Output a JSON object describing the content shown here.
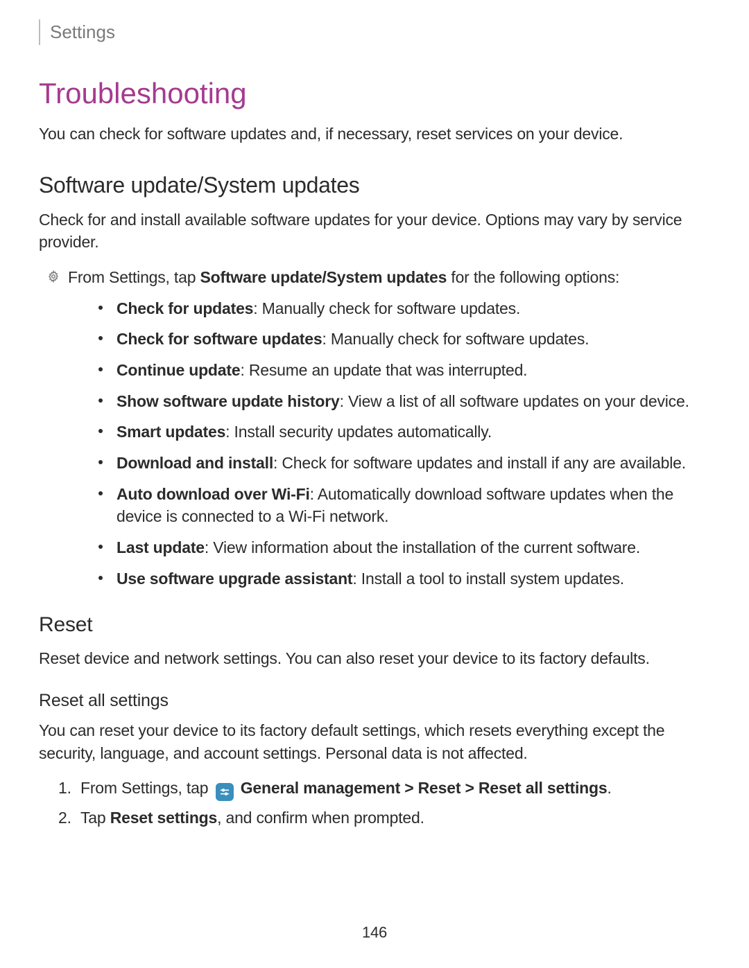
{
  "breadcrumb": "Settings",
  "title": "Troubleshooting",
  "intro": "You can check for software updates and, if necessary, reset services on your device.",
  "section_1": {
    "heading": "Software update/System updates",
    "body": "Check for and install available software updates for your device. Options may vary by service provider.",
    "gear_line_pre": "From Settings, tap ",
    "gear_line_bold": "Software update/System updates",
    "gear_line_post": " for the following options:",
    "bullets": [
      {
        "label": "Check for updates",
        "desc": ": Manually check for software updates."
      },
      {
        "label": "Check for software updates",
        "desc": ": Manually check for software updates."
      },
      {
        "label": "Continue update",
        "desc": ": Resume an update that was interrupted."
      },
      {
        "label": "Show software update history",
        "desc": ": View a list of all software updates on your device."
      },
      {
        "label": "Smart updates",
        "desc": ": Install security updates automatically."
      },
      {
        "label": "Download and install",
        "desc": ": Check for software updates and install if any are available."
      },
      {
        "label": "Auto download over Wi-Fi",
        "desc": ": Automatically download software updates when the device is connected to a Wi-Fi network."
      },
      {
        "label": "Last update",
        "desc": ": View information about the installation of the current software."
      },
      {
        "label": "Use software upgrade assistant",
        "desc": ": Install a tool to install system updates."
      }
    ]
  },
  "section_2": {
    "heading": "Reset",
    "body": "Reset device and network settings. You can also reset your device to its factory defaults."
  },
  "section_3": {
    "heading": "Reset all settings",
    "body": "You can reset your device to its factory default settings, which resets everything except the security, language, and account settings. Personal data is not affected.",
    "step1_pre": "From Settings, tap ",
    "step1_bold": "General management > Reset > Reset all settings",
    "step1_post": ".",
    "step2_pre": "Tap ",
    "step2_bold": "Reset settings",
    "step2_post": ", and confirm when prompted."
  },
  "page_number": "146"
}
